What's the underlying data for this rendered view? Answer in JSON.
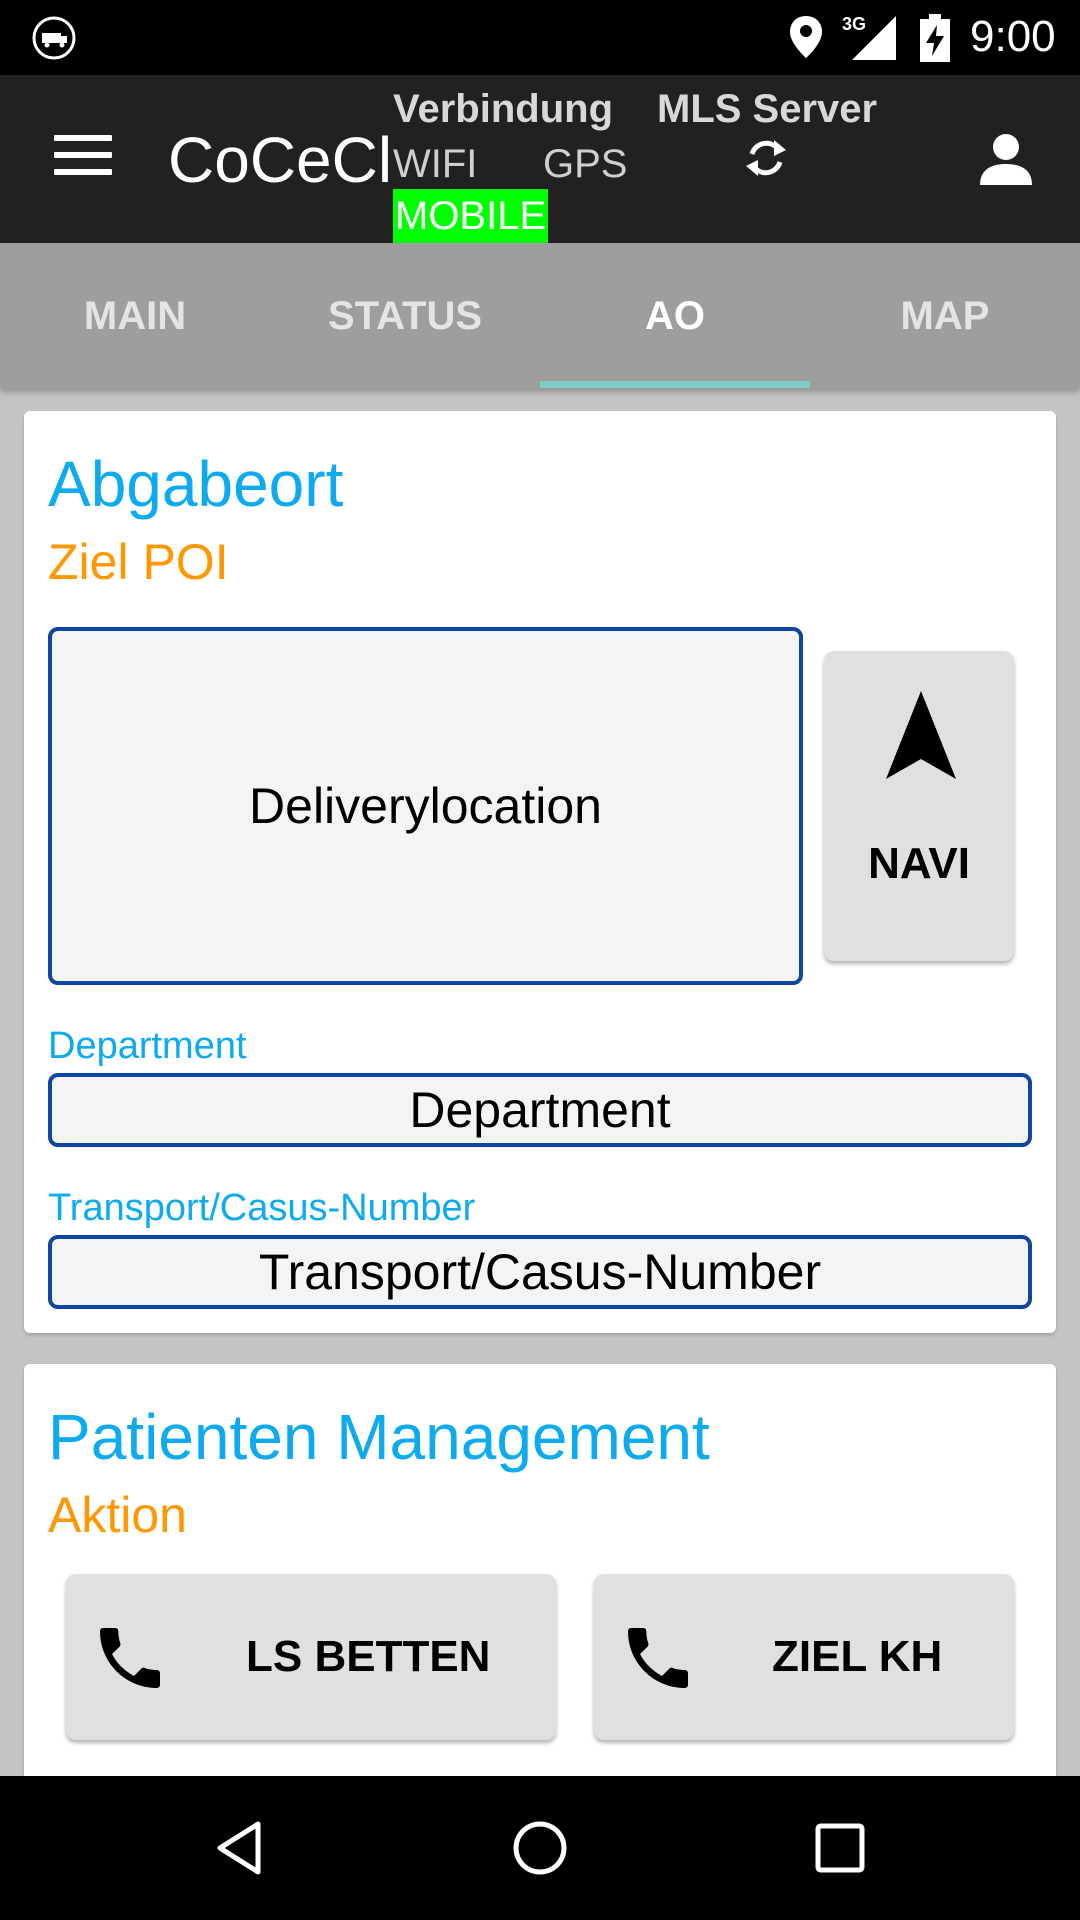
{
  "statusbar": {
    "network_type": "3G",
    "time": "9:00",
    "icons": [
      "ambulance-notification-icon",
      "location-icon",
      "signal-icon",
      "battery-charging-icon"
    ]
  },
  "toolbar": {
    "app_title": "CoCeCl",
    "connection_header": "Verbindung",
    "mls_header": "MLS Server",
    "wifi_label": "WIFI",
    "gps_label": "GPS",
    "mobile_label": "MOBILE",
    "icons": [
      "menu-icon",
      "sync-icon",
      "user-icon"
    ]
  },
  "tabs": [
    {
      "label": "MAIN",
      "active": false
    },
    {
      "label": "STATUS",
      "active": false
    },
    {
      "label": "AO",
      "active": true
    },
    {
      "label": "MAP",
      "active": false
    }
  ],
  "abgabeort": {
    "title": "Abgabeort",
    "subtitle": "Ziel POI",
    "location_value": "Deliverylocation",
    "navi_label": "NAVI",
    "department_label": "Department",
    "department_value": "Department",
    "transport_label": "Transport/Casus-Number",
    "transport_value": "Transport/Casus-Number"
  },
  "patienten": {
    "title": "Patienten Management",
    "subtitle": "Aktion",
    "buttons": [
      {
        "label": "LS BETTEN",
        "icon": "phone-icon"
      },
      {
        "label": "ZIEL KH",
        "icon": "phone-icon"
      }
    ]
  },
  "colors": {
    "toolbar": "#212121",
    "tabs": "#9e9e9e",
    "tab_indicator": "#80cbc4",
    "title_blue": "#0daaf0",
    "subtitle_orange": "#ff9800",
    "border_blue": "#0d47a1",
    "mobile_active": "#00ff00"
  },
  "navbar": {
    "icons": [
      "back-icon",
      "home-icon",
      "recents-icon"
    ]
  }
}
